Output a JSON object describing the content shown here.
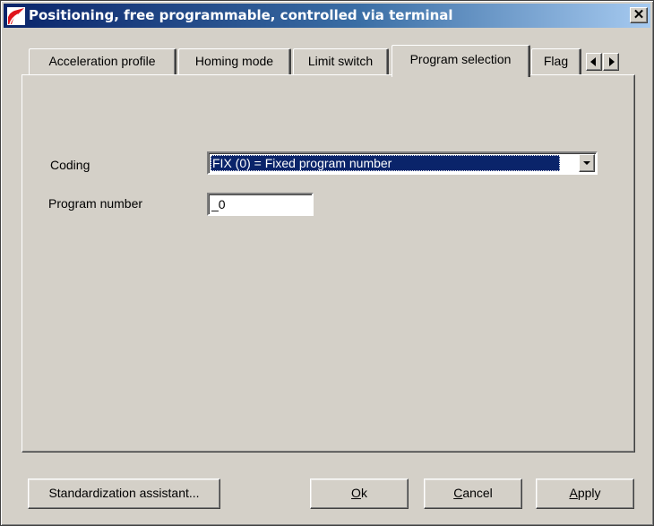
{
  "window": {
    "title": "Positioning, free programmable, controlled via terminal",
    "close_glyph": "✕"
  },
  "tabs": [
    {
      "label": "Acceleration profile",
      "active": false
    },
    {
      "label": "Homing mode",
      "active": false
    },
    {
      "label": "Limit switch",
      "active": false
    },
    {
      "label": "Program selection",
      "active": true
    },
    {
      "label": "Flag",
      "active": false
    }
  ],
  "tab_scroll": {
    "left_icon": "arrow-left-icon",
    "right_icon": "arrow-right-icon"
  },
  "form": {
    "coding": {
      "label": "Coding",
      "value": "FIX (0) = Fixed program number"
    },
    "program_number": {
      "label": "Program number",
      "value": "_0"
    }
  },
  "buttons": {
    "standardization": "Standardization assistant...",
    "ok_accel": "O",
    "ok_rest": "k",
    "cancel_accel": "C",
    "cancel_rest": "ancel",
    "apply_accel": "A",
    "apply_rest": "pply"
  },
  "colors": {
    "face": "#d4d0c8",
    "title_start": "#0a246a",
    "title_end": "#a6caf0",
    "selection": "#0a246a"
  }
}
